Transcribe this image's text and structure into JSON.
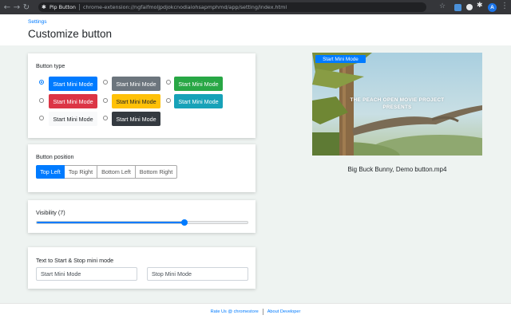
{
  "browser": {
    "tab_title": "Pip Button",
    "url": "chrome-extension://ngfaifmoljpdjokcnodiaiohsapmphmd/app/setting/index.html",
    "avatar_initial": "A",
    "icons": [
      "back-arrow-icon",
      "forward-arrow-icon",
      "reload-icon",
      "puzzle-icon",
      "star-icon",
      "kebab-menu-icon"
    ]
  },
  "header": {
    "breadcrumb": "Settings",
    "title": "Customize button"
  },
  "button_type": {
    "label": "Button type",
    "selected_index": 0,
    "options": [
      {
        "label": "Start Mini Mode",
        "style": "primary",
        "color": "#007bff"
      },
      {
        "label": "Start Mini Mode",
        "style": "secondary",
        "color": "#6c757d"
      },
      {
        "label": "Start Mini Mode",
        "style": "success",
        "color": "#28a745"
      },
      {
        "label": "Start Mini Mode",
        "style": "danger",
        "color": "#dc3545"
      },
      {
        "label": "Start Mini Mode",
        "style": "warning",
        "color": "#ffc107"
      },
      {
        "label": "Start Mini Mode",
        "style": "info",
        "color": "#17a2b8"
      },
      {
        "label": "Start Mini Mode",
        "style": "light",
        "color": "#f8f9fa"
      },
      {
        "label": "Start Mini Mode",
        "style": "dark",
        "color": "#343a40"
      }
    ]
  },
  "button_position": {
    "label": "Button position",
    "selected": "Top Left",
    "options": [
      "Top Left",
      "Top Right",
      "Bottom Left",
      "Bottom Right"
    ]
  },
  "visibility": {
    "label": "Visibility (7)",
    "value": 7,
    "min": 0,
    "max": 10
  },
  "text_settings": {
    "label": "Text to Start & Stop mini mode",
    "start_value": "Start Mini Mode",
    "stop_value": "Stop Mini Mode"
  },
  "preview": {
    "button_label": "Start Mini Mode",
    "video_title_line1": "THE PEACH OPEN MOVIE PROJECT",
    "video_title_line2": "PRESENTS",
    "caption": "Big Buck Bunny, Demo button.mp4"
  },
  "footer": {
    "rate_link": "Rate Us @ chromestore",
    "about_link": "About Developer"
  },
  "colors": {
    "accent": "#007bff",
    "page_bg": "#eef3f1",
    "chrome_bg": "#35363a"
  }
}
